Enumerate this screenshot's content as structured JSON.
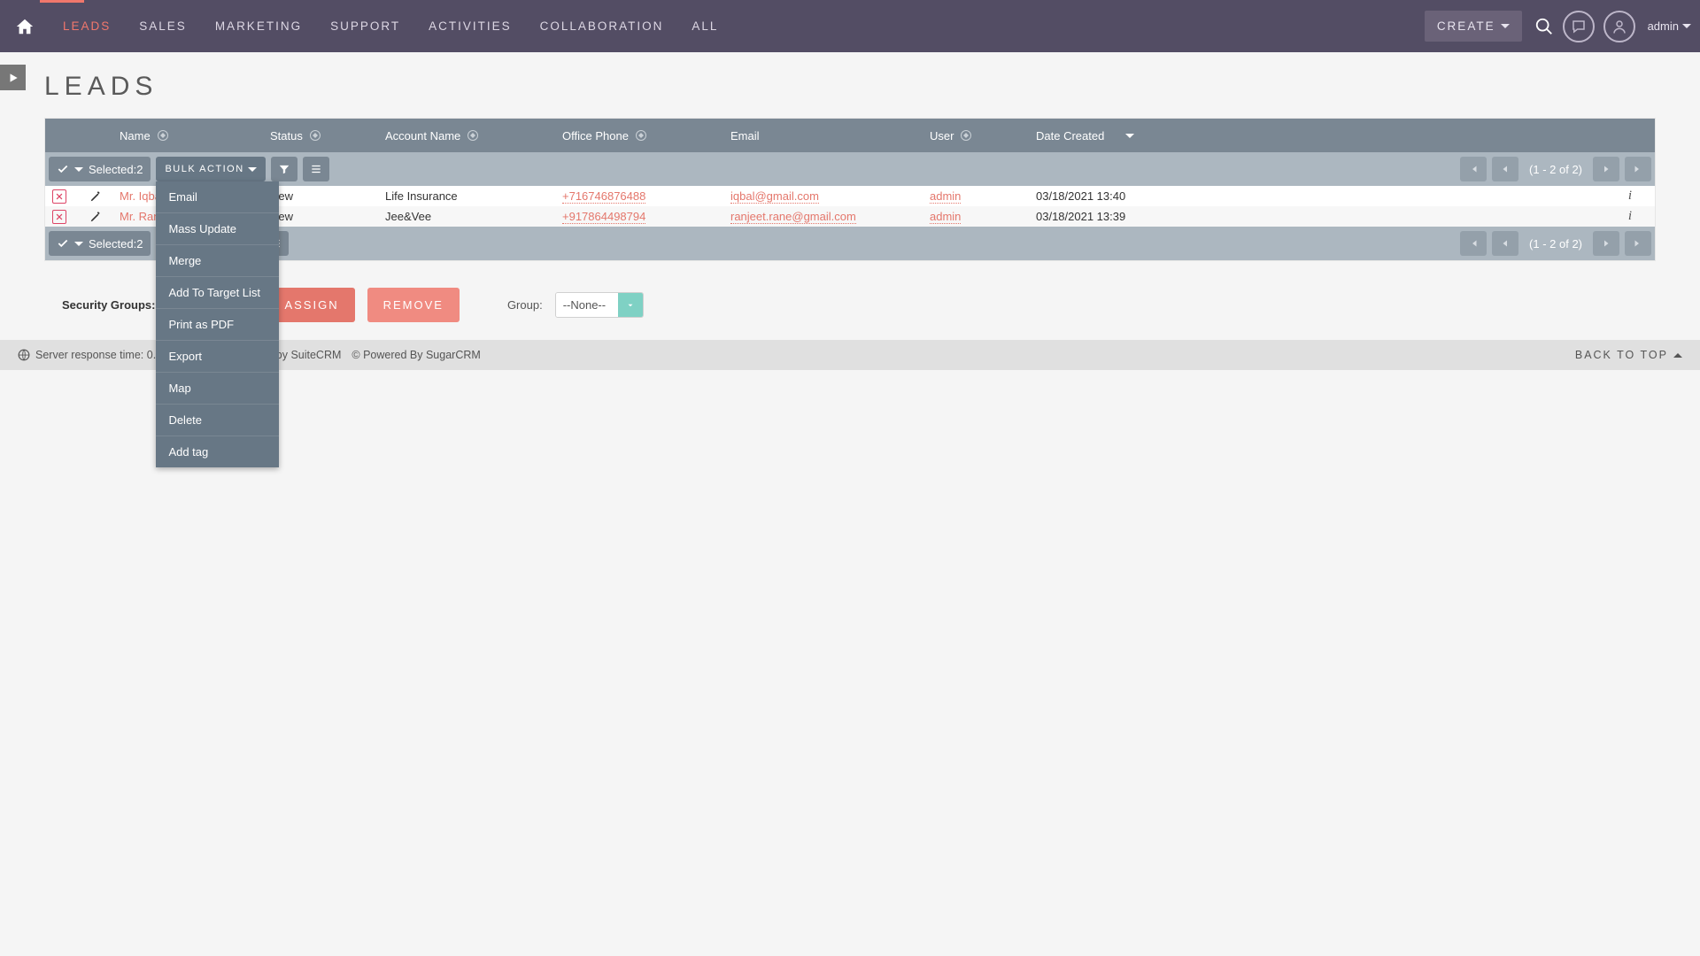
{
  "nav": {
    "items": [
      "LEADS",
      "SALES",
      "MARKETING",
      "SUPPORT",
      "ACTIVITIES",
      "COLLABORATION",
      "ALL"
    ],
    "active": 0,
    "create": "CREATE",
    "user": "admin"
  },
  "page": {
    "title": "LEADS"
  },
  "table": {
    "headers": {
      "name": "Name",
      "status": "Status",
      "account": "Account Name",
      "phone": "Office Phone",
      "email": "Email",
      "user": "User",
      "date": "Date Created"
    },
    "selected_label": "Selected:2",
    "bulk_label": "BULK ACTION",
    "page_range": "(1 - 2 of 2)",
    "rows": [
      {
        "name": "Mr. Iqbal",
        "status": "New",
        "account": "Life Insurance",
        "phone": "+716746876488",
        "email": "iqbal@gmail.com",
        "user": "admin",
        "date": "03/18/2021 13:40"
      },
      {
        "name": "Mr. Ranjeet",
        "status": "New",
        "account": "Jee&Vee",
        "phone": "+917864498794",
        "email": "ranjeet.rane@gmail.com",
        "user": "admin",
        "date": "03/18/2021 13:39"
      }
    ]
  },
  "bulk_menu": [
    "Email",
    "Mass Update",
    "Merge",
    "Add To Target List",
    "Print as PDF",
    "Export",
    "Map",
    "Delete",
    "Add tag"
  ],
  "sec": {
    "label": "Security Groups:",
    "assign": "ASSIGN",
    "remove": "REMOVE",
    "group_label": "Group:",
    "group_value": "--None--"
  },
  "footer": {
    "resp": "Server response time: 0.2",
    "by": "charged by SuiteCRM",
    "pw": "© Powered By SugarCRM",
    "back": "BACK TO TOP"
  }
}
